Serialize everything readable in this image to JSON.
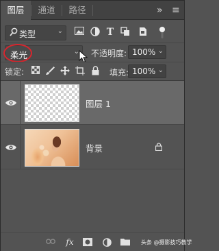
{
  "tabs": [
    {
      "label": "图层",
      "active": true
    },
    {
      "label": "通道",
      "active": false
    },
    {
      "label": "路径",
      "active": false
    }
  ],
  "panel_menu": {
    "collapse_glyph": "»",
    "menu_glyph": "≡"
  },
  "filter": {
    "icon": "search-icon",
    "label": "类型",
    "chevron": "⌄"
  },
  "filter_icons": [
    "image-filter-icon",
    "adjustment-filter-icon",
    "type-filter-icon",
    "shape-filter-icon",
    "smart-object-filter-icon",
    "filter-toggle-icon"
  ],
  "blend_mode": {
    "value": "柔光",
    "chevron": "⌄",
    "highlight_color": "#d8262e"
  },
  "opacity": {
    "label": "不透明度:",
    "value": "100%",
    "chevron": "⌄"
  },
  "lock": {
    "label": "锁定:",
    "icons": [
      "lock-transparent-icon",
      "lock-image-icon",
      "lock-position-icon",
      "lock-artboard-icon",
      "lock-all-icon"
    ]
  },
  "fill": {
    "label": "填充:",
    "value": "100%",
    "chevron": "⌄"
  },
  "layers": [
    {
      "name": "图层 1",
      "visible": true,
      "selected": true,
      "thumbnail": "transparent",
      "locked": false
    },
    {
      "name": "背景",
      "visible": true,
      "selected": false,
      "thumbnail": "photo",
      "locked": true
    }
  ],
  "bottom_icons": [
    "link-icon",
    "fx-icon",
    "mask-icon",
    "adjustment-icon",
    "group-folder-icon",
    "new-layer-icon",
    "trash-icon"
  ],
  "bottom": {
    "fx_label": "fx"
  },
  "watermark": "头条 @摄影技巧教学"
}
